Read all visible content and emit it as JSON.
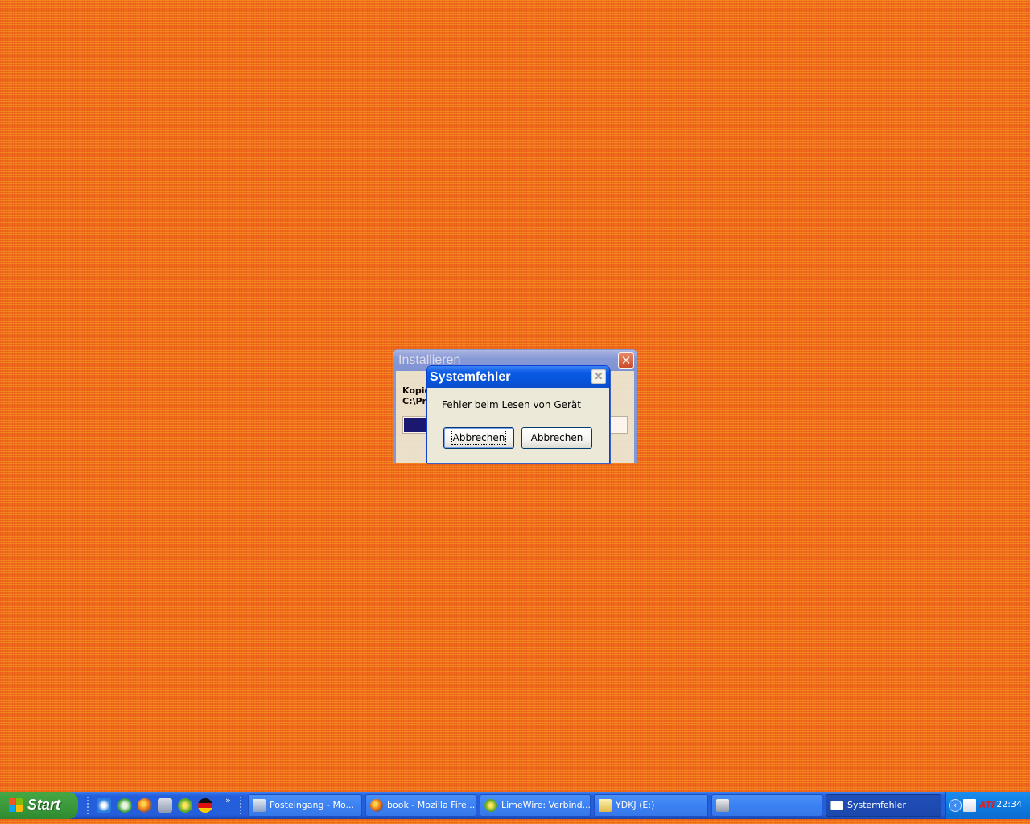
{
  "install_window": {
    "title": "Installieren",
    "line1": "Kopie",
    "line2": "C:\\Pr",
    "close_glyph": "✕",
    "progress": 0.1
  },
  "error_dialog": {
    "title": "Systemfehler",
    "message": "Fehler beim Lesen von Gerät",
    "close_glyph": "✕",
    "buttons": [
      "Abbrechen",
      "Abbrechen"
    ]
  },
  "taskbar": {
    "start_label": "Start",
    "quick_launch": [
      "outlook-express-icon",
      "recycle-icon",
      "firefox-icon",
      "printer-icon",
      "limewire-icon",
      "flag-icon"
    ],
    "chevron": "»",
    "tasks": [
      {
        "label": "Posteingang - Mo...",
        "icon": "mail-icon"
      },
      {
        "label": "book - Mozilla Fire...",
        "icon": "firefox-icon"
      },
      {
        "label": "LimeWire: Verbind...",
        "icon": "limewire-icon"
      },
      {
        "label": "YDKJ (E:)",
        "icon": "folder-icon"
      },
      {
        "label": "",
        "icon": "network-computer-icon"
      },
      {
        "label": "Systemfehler",
        "icon": "window-icon",
        "active": true
      }
    ],
    "tray": {
      "time": "22:34",
      "icons": [
        "expand-arrow-icon",
        "mail-notify-icon",
        "ati-icon"
      ]
    }
  }
}
